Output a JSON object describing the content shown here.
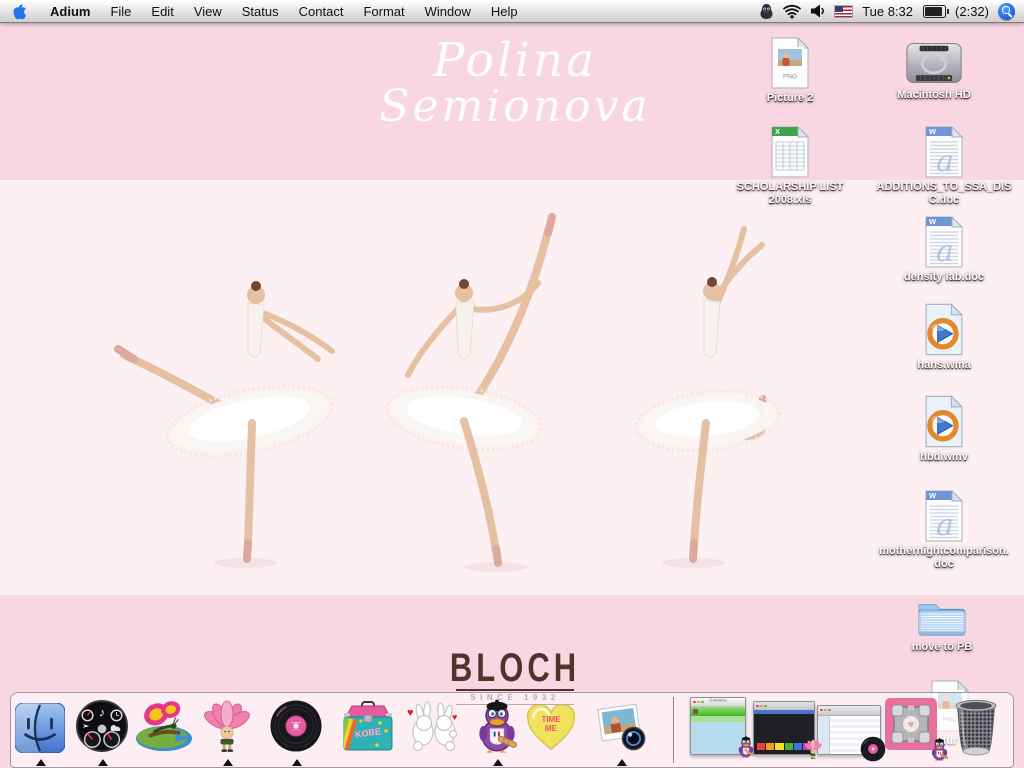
{
  "menu_bar": {
    "app_name": "Adium",
    "menus": [
      "File",
      "Edit",
      "View",
      "Status",
      "Contact",
      "Format",
      "Window",
      "Help"
    ],
    "clock": "Tue 8:32",
    "battery_remaining": "(2:32)",
    "status_icon_names": [
      "adium-duck-icon",
      "wifi-icon",
      "volume-icon",
      "us-flag-input-icon",
      "battery-icon",
      "spotlight-icon"
    ]
  },
  "wallpaper": {
    "artist_line1": "Polina",
    "artist_line2": "Semionova",
    "brand": "BLOCH",
    "brand_tagline": "SINCE 1932",
    "subject": "three ballerinas in white tutus on pink background",
    "colors": {
      "band_pink": "#f9d7e2",
      "center_pink": "#fdf0f2",
      "brand_brown": "#53322c"
    }
  },
  "desktop": {
    "icons": [
      {
        "label": "Picture 2",
        "type": "png-image"
      },
      {
        "label": "Macintosh HD",
        "type": "hard-drive"
      },
      {
        "label": "SCHOLARSHIP LIST 2008.xls",
        "type": "excel-spreadsheet"
      },
      {
        "label": "ADDITIONS_TO_SSA_DISC.doc",
        "type": "word-document"
      },
      {
        "label": "density lab.doc",
        "type": "word-document"
      },
      {
        "label": "hans.wma",
        "type": "windows-media-audio"
      },
      {
        "label": "hbd.wmv",
        "type": "windows-media-video"
      },
      {
        "label": "mothernightcomparison.doc",
        "type": "word-document"
      },
      {
        "label": "move to PB",
        "type": "folder"
      },
      {
        "label": "tur",
        "type": "png-image"
      }
    ]
  },
  "file_icon_glyphs": {
    "word_flag": "W",
    "excel_flag": "X",
    "word_watermark": "a",
    "png_badge": "PNG"
  },
  "glyphs": {
    "heart": "♥",
    "note": "♪"
  },
  "dock": {
    "apps": [
      {
        "name": "finder"
      },
      {
        "name": "dashboard"
      },
      {
        "name": "butterfly-pond"
      },
      {
        "name": "lotus-sprite"
      },
      {
        "name": "vinyl-record"
      },
      {
        "name": "kobe-lunchbox",
        "text": "KOBE"
      },
      {
        "name": "kissing-bunnies"
      },
      {
        "name": "beret-duck"
      },
      {
        "name": "candy-heart",
        "text": "TIME ME"
      },
      {
        "name": "iphoto"
      }
    ],
    "running_app_indexes": [
      0,
      1,
      3,
      4,
      7,
      9
    ],
    "minimized_windows": [
      {
        "name": "adium-contacts-window",
        "title": "Contacts",
        "badge": "beret-duck"
      },
      {
        "name": "browser-window",
        "badge": "lotus-sprite"
      },
      {
        "name": "itunes-window",
        "badge": "vinyl-record"
      },
      {
        "name": "companion-cube-image",
        "badge": "beret-duck"
      }
    ],
    "trash": {
      "name": "trash"
    }
  }
}
